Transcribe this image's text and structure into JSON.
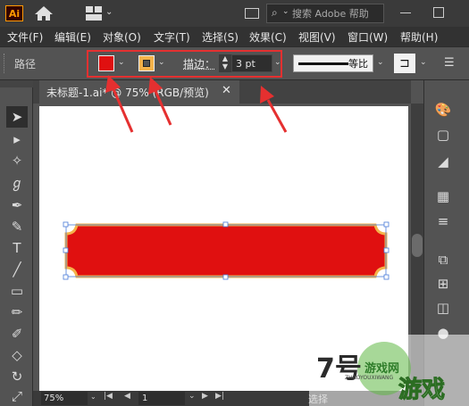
{
  "app": {
    "logo": "Ai"
  },
  "titlebar": {
    "search_placeholder": "搜索 Adobe 帮助",
    "icons": [
      "home-icon",
      "workspace-grid-icon",
      "panel-toggle-icon",
      "search-icon",
      "minimize-icon",
      "maximize-icon"
    ]
  },
  "menu": {
    "items": [
      "文件(F)",
      "编辑(E)",
      "对象(O)",
      "文字(T)",
      "选择(S)",
      "效果(C)",
      "视图(V)",
      "窗口(W)",
      "帮助(H)"
    ]
  },
  "control": {
    "selection_type": "路径",
    "fill_color": "#e01010",
    "stroke_color": "#f4b24a",
    "stroke_label": "描边：",
    "stroke_weight": "3 pt",
    "profile_label": "等比"
  },
  "document": {
    "tab_title": "未标题-1.ai* @ 75% (RGB/预览)",
    "close_glyph": "✕"
  },
  "toolbar": {
    "tools": [
      "selection-tool",
      "direct-selection-tool",
      "magic-wand-tool",
      "lasso-tool",
      "pen-tool",
      "curvature-tool",
      "type-tool",
      "line-tool",
      "rectangle-tool",
      "paintbrush-tool",
      "shaper-tool",
      "eraser-tool",
      "rotate-tool",
      "scale-tool"
    ]
  },
  "rightpanel": {
    "icons": [
      "color-panel-icon",
      "document-panel-icon",
      "color-guide-icon",
      "swatches-icon",
      "stroke-panel-icon",
      "transform-icon",
      "align-icon",
      "pathfinder-icon",
      "appearance-icon"
    ]
  },
  "status": {
    "zoom": "75%",
    "page": "1",
    "label": "选择"
  },
  "shape": {
    "fill": "#e01010",
    "stroke": "#f4b24a"
  },
  "annotation": {
    "color": "#e53030"
  },
  "watermark": {
    "brand": "7号游戏网",
    "latin": "ZHAOYOUXIWANG",
    "cn": "游戏"
  }
}
